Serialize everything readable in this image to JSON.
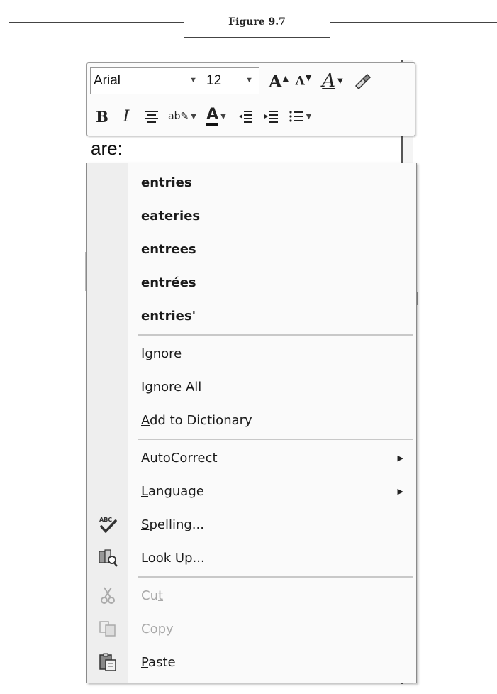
{
  "figure": {
    "caption": "Figure 9.7"
  },
  "mini_toolbar": {
    "font_name": "Arial",
    "font_size": "12",
    "grow_font_glyph": "A",
    "shrink_font_glyph": "A",
    "styles_glyph": "A",
    "bold_glyph": "B",
    "italic_glyph": "I",
    "font_color_glyph": "A",
    "highlight_glyph": "ab"
  },
  "document": {
    "visible_word": "are:"
  },
  "context_menu": {
    "suggestions": [
      "entries",
      "eateries",
      "entrees",
      "entrées",
      "entries'"
    ],
    "ignore": {
      "pre": "I",
      "key": "g",
      "post": "nore"
    },
    "ignore_all": {
      "pre": "",
      "key": "I",
      "post": "gnore All"
    },
    "add_to_dictionary": {
      "pre": "",
      "key": "A",
      "post": "dd to Dictionary"
    },
    "autocorrect": {
      "pre": "A",
      "key": "u",
      "post": "toCorrect"
    },
    "language": {
      "pre": "",
      "key": "L",
      "post": "anguage"
    },
    "spelling": {
      "pre": "",
      "key": "S",
      "post": "pelling..."
    },
    "look_up": {
      "pre": "Loo",
      "key": "k",
      "post": " Up..."
    },
    "cut": {
      "pre": "Cu",
      "key": "t",
      "post": ""
    },
    "copy": {
      "pre": "",
      "key": "C",
      "post": "opy"
    },
    "paste": {
      "pre": "",
      "key": "P",
      "post": "aste"
    },
    "spelling_icon_text": "ABC"
  },
  "icons": [
    "font-dropdown-arrow",
    "size-dropdown-arrow",
    "grow-font-icon",
    "shrink-font-icon",
    "styles-icon",
    "format-painter-icon",
    "bold-icon",
    "italic-icon",
    "center-align-icon",
    "highlight-icon",
    "font-color-icon",
    "decrease-indent-icon",
    "increase-indent-icon",
    "bullets-icon",
    "submenu-arrow-icon",
    "spelling-icon",
    "research-icon",
    "scissors-icon",
    "copy-icon",
    "paste-icon"
  ]
}
